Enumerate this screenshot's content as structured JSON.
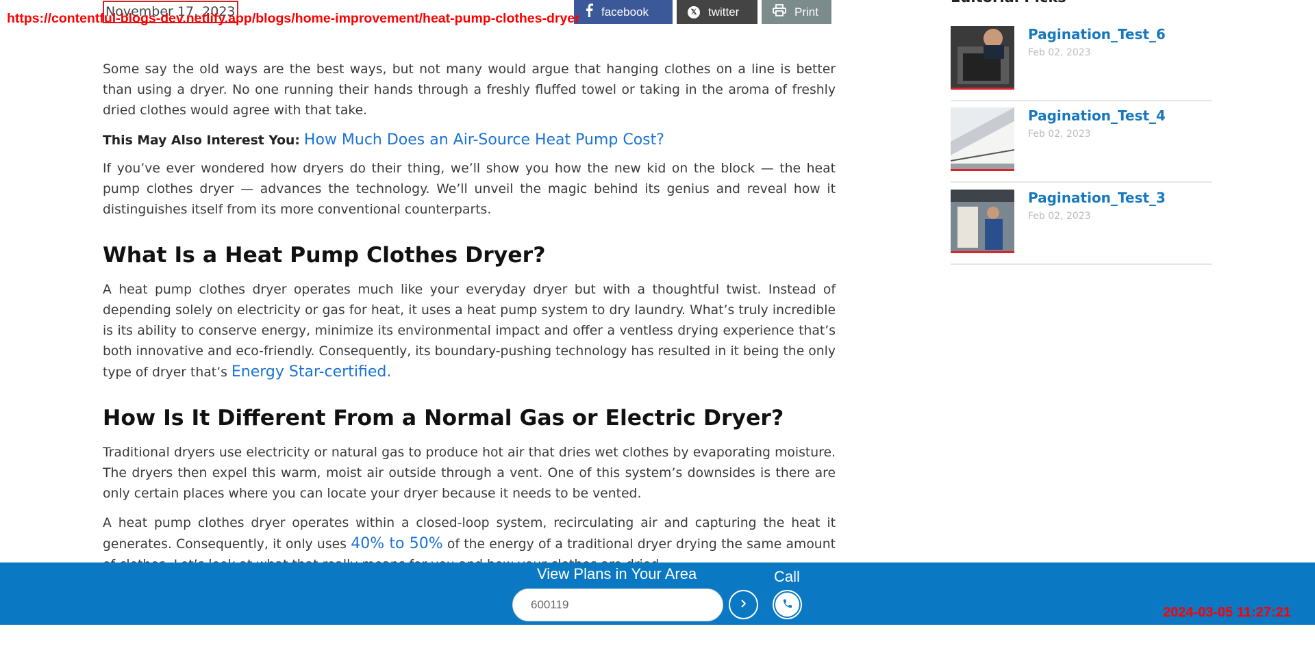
{
  "overlay": {
    "url": "https://contentful-blogs-dev.netlify.app/blogs/home-improvement/heat-pump-clothes-dryer",
    "timestamp": "2024-03-05 11:27:21"
  },
  "post": {
    "date": "November 17, 2023"
  },
  "share": {
    "facebook": "facebook",
    "twitter": "twitter",
    "print": "Print"
  },
  "article": {
    "p1": "Some say the old ways are the best ways, but not many would argue that hanging clothes on a line is better than using a dryer. No one running their hands through a freshly fluffed towel or taking in the aroma of freshly dried clothes would agree with that take.",
    "interest_label": "This May Also Interest You:",
    "interest_link": "How Much Does an Air-Source Heat Pump Cost?",
    "p2": "If you’ve ever wondered how dryers do their thing, we’ll show you how the new kid on the block — the heat pump clothes dryer — advances the technology. We’ll unveil the magic behind its genius and reveal how it distinguishes itself from its more conventional counterparts.",
    "h2_1": "What Is a Heat Pump Clothes Dryer?",
    "p3": "A heat pump clothes dryer operates much like your everyday dryer but with a thoughtful twist. Instead of depending solely on electricity or gas for heat, it uses a heat pump system to dry laundry. What’s truly incredible is its ability to conserve energy, minimize its environmental impact and offer a ventless drying experience that’s both innovative and eco-friendly. Consequently, its boundary-pushing technology has resulted in it being the only type of dryer that’s",
    "p3_link": "Energy Star-certified.",
    "h2_2": "How Is It Different From a Normal Gas or Electric Dryer?",
    "p4": "Traditional dryers use electricity or natural gas to produce hot air that dries wet clothes by evaporating moisture. The dryers then expel this warm, moist air outside through a vent. One of this system’s downsides is there are only certain places where you can locate your dryer because it needs to be vented.",
    "p5_a": "A heat pump clothes dryer operates within a closed-loop system, recirculating air and capturing the heat it generates. Consequently, it only uses",
    "p5_link": "40% to 50%",
    "p5_b": "of the energy of a traditional dryer drying the same amount of clothes. Let’s look at what that really means for you and how your clothes are dried."
  },
  "sidebar": {
    "heading": "Editorial Picks",
    "items": [
      {
        "title": "Pagination_Test_6",
        "date": "Feb 02, 2023"
      },
      {
        "title": "Pagination_Test_4",
        "date": "Feb 02, 2023"
      },
      {
        "title": "Pagination_Test_3",
        "date": "Feb 02, 2023"
      }
    ]
  },
  "footer": {
    "label": "View Plans in Your Area",
    "zip_value": "600119",
    "call_label": "Call"
  },
  "colors": {
    "footer_bg": "#0a78c2",
    "link": "#1a73d6",
    "sidebar_link": "#1878be",
    "accent_red": "#d9232d"
  }
}
